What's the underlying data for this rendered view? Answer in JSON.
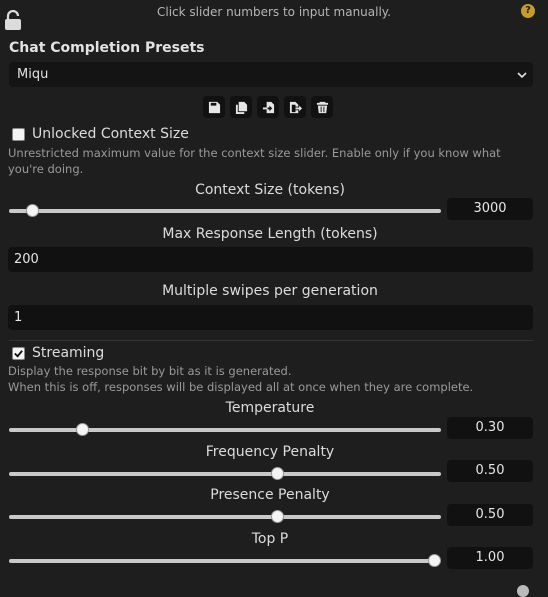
{
  "header": {
    "hint": "Click slider numbers to input manually.",
    "help_glyph": "?"
  },
  "presets": {
    "title": "Chat Completion Presets",
    "selected": "Miqu",
    "chevron": "⌄",
    "actions": [
      "save-icon",
      "copy-icon",
      "import-icon",
      "export-icon",
      "delete-icon"
    ]
  },
  "unlocked": {
    "label": "Unlocked Context Size",
    "checked": false,
    "description": "Unrestricted maximum value for the context size slider. Enable only if you know what you're doing."
  },
  "context_size": {
    "label": "Context Size (tokens)",
    "value": "3000",
    "fraction": 0.04
  },
  "max_response": {
    "label": "Max Response Length (tokens)",
    "value": "200"
  },
  "swipes": {
    "label": "Multiple swipes per generation",
    "value": "1"
  },
  "streaming": {
    "label": "Streaming",
    "checked": true,
    "description_1": "Display the response bit by bit as it is generated.",
    "description_2": "When this is off, responses will be displayed all at once when they are complete."
  },
  "temperature": {
    "label": "Temperature",
    "value": "0.30",
    "fraction": 0.16
  },
  "frequency_penalty": {
    "label": "Frequency Penalty",
    "value": "0.50",
    "fraction": 0.625
  },
  "presence_penalty": {
    "label": "Presence Penalty",
    "value": "0.50",
    "fraction": 0.625
  },
  "top_p": {
    "label": "Top P",
    "value": "1.00",
    "fraction": 1.0
  },
  "colors": {
    "background": "#1e1e1e",
    "help_badge": "#c79c2d",
    "input_bg": "#111111"
  }
}
